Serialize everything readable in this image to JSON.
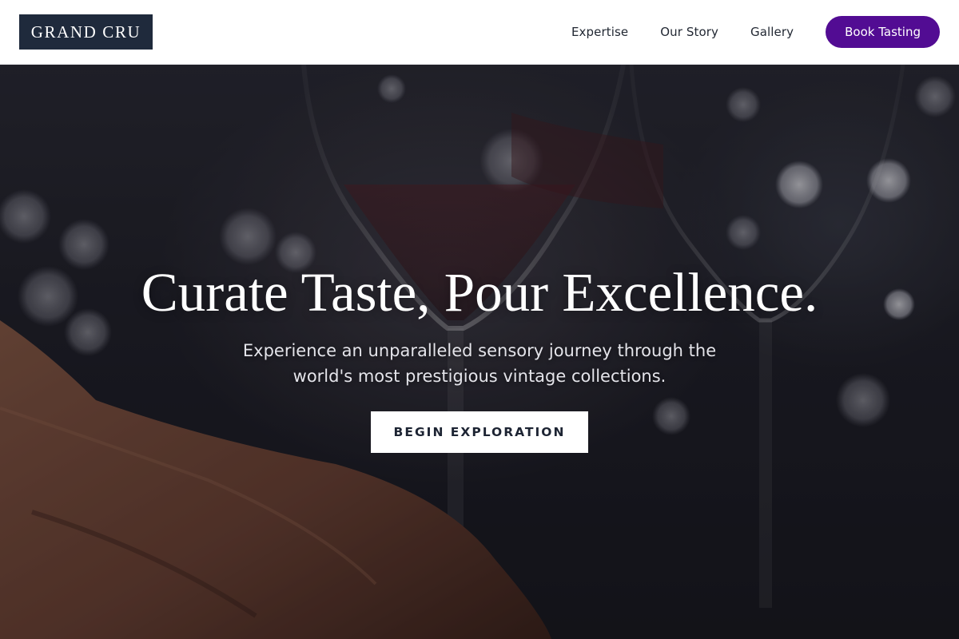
{
  "header": {
    "logo": "GRAND CRU",
    "nav": [
      {
        "label": "Expertise"
      },
      {
        "label": "Our Story"
      },
      {
        "label": "Gallery"
      }
    ],
    "cta_label": "Book Tasting"
  },
  "hero": {
    "title": "Curate Taste, Pour Excellence.",
    "subtitle": "Experience an unparalleled sensory journey through the world's most prestigious vintage collections.",
    "button_label": "BEGIN EXPLORATION"
  },
  "colors": {
    "logo_bg": "#1f2a3c",
    "cta_bg": "#520c93",
    "hero_text": "#ffffff"
  },
  "icons": [
    "wine-glass-photo"
  ]
}
